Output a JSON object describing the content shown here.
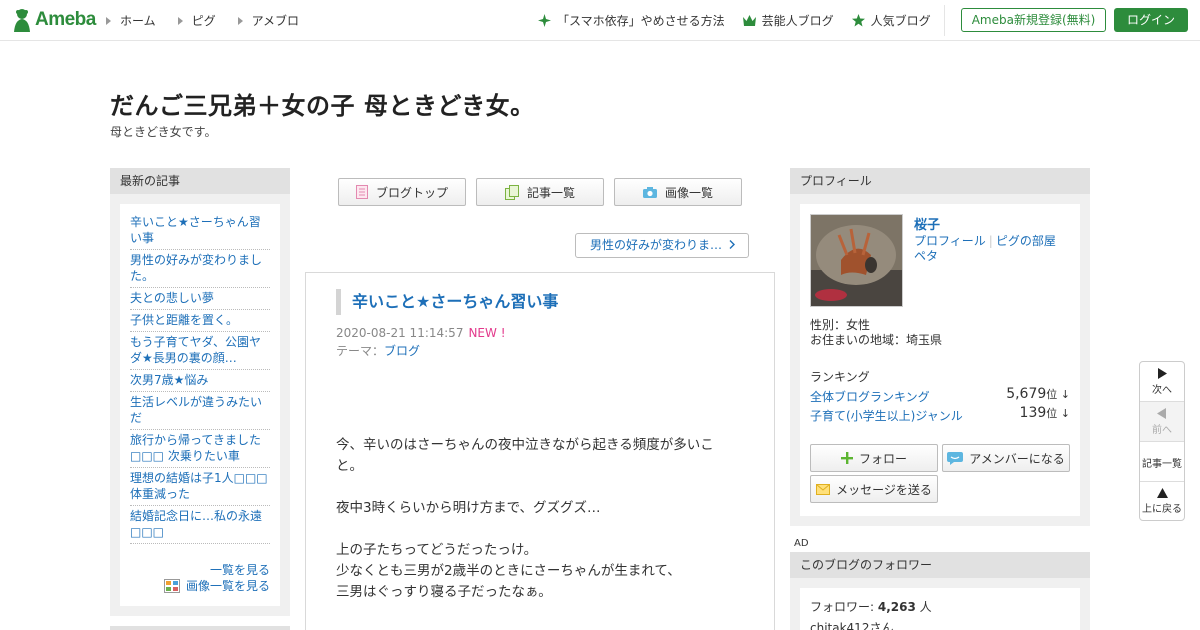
{
  "header": {
    "logo_text": "Ameba",
    "nav": [
      "ホーム",
      "ピグ",
      "アメブロ"
    ],
    "right_nav": [
      {
        "label": "「スマホ依存」やめさせる方法",
        "icon": "sparkle-icon"
      },
      {
        "label": "芸能人ブログ",
        "icon": "crown-icon"
      },
      {
        "label": "人気ブログ",
        "icon": "star-icon"
      }
    ],
    "register_label": "Ameba新規登録(無料)",
    "login_label": "ログイン"
  },
  "blog": {
    "title": "だんご三兄弟＋女の子 母ときどき女。",
    "description": "母ときどき女です。"
  },
  "recent": {
    "heading": "最新の記事",
    "items": [
      "辛いこと★さーちゃん習い事",
      "男性の好みが変わりました。",
      "夫との悲しい夢",
      "子供と距離を置く。",
      "もう子育てヤダ、公園ヤダ★長男の裏の顔…",
      "次男7歳★悩み",
      "生活レベルが違うみたいだ",
      "旅行から帰ってきました □□□ 次乗りたい車",
      "理想の結婚は子1人□□□ 体重減った",
      "結婚記念日に…私の永遠 □□□"
    ],
    "see_list": "一覧を見る",
    "see_images": "画像一覧を見る"
  },
  "tabs": {
    "blog_top": "ブログトップ",
    "entries": "記事一覧",
    "images": "画像一覧"
  },
  "next_entry": "男性の好みが変わりま…",
  "article": {
    "title": "辛いこと★さーちゃん習い事",
    "date": "2020-08-21 11:14:57",
    "new_badge": "NEW !",
    "theme_label": "テーマ：",
    "theme": "ブログ",
    "body": {
      "p1": "今、辛いのはさーちゃんの夜中泣きながら起きる頻度が多いこと。",
      "p2": "夜中3時くらいから明け方まで、グズグズ…",
      "p3a": "上の子たちってどうだったっけ。",
      "p3b": "少なくとも三男が2歳半のときにさーちゃんが生まれて、",
      "p3c": "三男はぐっすり寝る子だったなぁ。"
    }
  },
  "profile": {
    "heading": "プロフィール",
    "name": "桜子",
    "link_profile": "プロフィール",
    "link_pig": "ピグの部屋",
    "link_peta": "ペタ",
    "gender": "性別：女性",
    "region": "お住まいの地域：埼玉県",
    "ranking_heading": "ランキング",
    "ranking": [
      {
        "label": "全体ブログランキング",
        "value": "5,679",
        "unit": "位 ↓"
      },
      {
        "label": "子育て(小学生以上)ジャンル",
        "value": "139",
        "unit": "位 ↓"
      }
    ],
    "follow_label": "フォロー",
    "amember_label": "アメンバーになる",
    "message_label": "メッセージを送る"
  },
  "ad_label": "AD",
  "followers": {
    "heading": "このブログのフォロワー",
    "label": "フォロワー: ",
    "count": "4,263",
    "unit": " 人",
    "first": "chitak412さん"
  },
  "float_nav": {
    "next": "次へ",
    "prev": "前へ",
    "list": "記事一覧",
    "top": "上に戻る"
  },
  "colors": {
    "brand_green": "#2d8c3c",
    "link_blue": "#1d6fb8",
    "new_pink": "#e33a8c"
  }
}
